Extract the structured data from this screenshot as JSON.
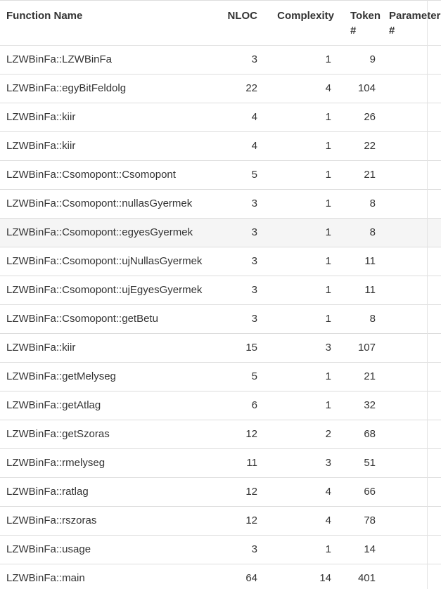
{
  "table": {
    "headers": {
      "name": "Function Name",
      "nloc": "NLOC",
      "complexity": "Complexity",
      "token_line1": "Token",
      "token_line2": "#",
      "param_line1": "Parameter",
      "param_line2": "#"
    },
    "rows": [
      {
        "name": "LZWBinFa::LZWBinFa",
        "nloc": "3",
        "complexity": "1",
        "token": "9"
      },
      {
        "name": "LZWBinFa::egyBitFeldolg",
        "nloc": "22",
        "complexity": "4",
        "token": "104"
      },
      {
        "name": "LZWBinFa::kiir",
        "nloc": "4",
        "complexity": "1",
        "token": "26"
      },
      {
        "name": "LZWBinFa::kiir",
        "nloc": "4",
        "complexity": "1",
        "token": "22"
      },
      {
        "name": "LZWBinFa::Csomopont::Csomopont",
        "nloc": "5",
        "complexity": "1",
        "token": "21"
      },
      {
        "name": "LZWBinFa::Csomopont::nullasGyermek",
        "nloc": "3",
        "complexity": "1",
        "token": "8"
      },
      {
        "name": "LZWBinFa::Csomopont::egyesGyermek",
        "nloc": "3",
        "complexity": "1",
        "token": "8"
      },
      {
        "name": "LZWBinFa::Csomopont::ujNullasGyermek",
        "nloc": "3",
        "complexity": "1",
        "token": "11"
      },
      {
        "name": "LZWBinFa::Csomopont::ujEgyesGyermek",
        "nloc": "3",
        "complexity": "1",
        "token": "11"
      },
      {
        "name": "LZWBinFa::Csomopont::getBetu",
        "nloc": "3",
        "complexity": "1",
        "token": "8"
      },
      {
        "name": "LZWBinFa::kiir",
        "nloc": "15",
        "complexity": "3",
        "token": "107"
      },
      {
        "name": "LZWBinFa::getMelyseg",
        "nloc": "5",
        "complexity": "1",
        "token": "21"
      },
      {
        "name": "LZWBinFa::getAtlag",
        "nloc": "6",
        "complexity": "1",
        "token": "32"
      },
      {
        "name": "LZWBinFa::getSzoras",
        "nloc": "12",
        "complexity": "2",
        "token": "68"
      },
      {
        "name": "LZWBinFa::rmelyseg",
        "nloc": "11",
        "complexity": "3",
        "token": "51"
      },
      {
        "name": "LZWBinFa::ratlag",
        "nloc": "12",
        "complexity": "4",
        "token": "66"
      },
      {
        "name": "LZWBinFa::rszoras",
        "nloc": "12",
        "complexity": "4",
        "token": "78"
      },
      {
        "name": "LZWBinFa::usage",
        "nloc": "3",
        "complexity": "1",
        "token": "14"
      },
      {
        "name": "LZWBinFa::main",
        "nloc": "64",
        "complexity": "14",
        "token": "401"
      }
    ]
  }
}
